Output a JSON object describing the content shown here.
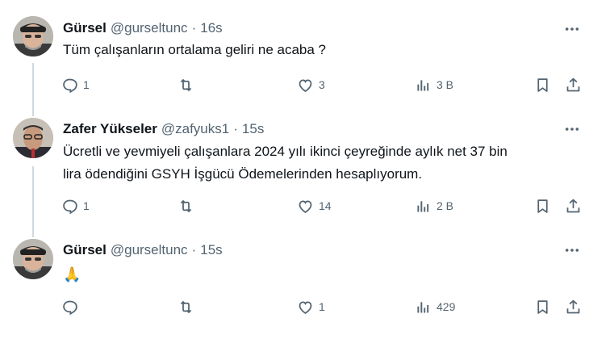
{
  "tweets": [
    {
      "name": "Gürsel",
      "handle": "@gurseltunc",
      "dot": "·",
      "time": "16s",
      "text": "Tüm çalışanların ortalama geliri ne acaba ?",
      "replies": "1",
      "retweets": "",
      "likes": "3",
      "views": "3 B"
    },
    {
      "name": "Zafer Yükseler",
      "handle": "@zafyuks1",
      "dot": "·",
      "time": "15s",
      "text_line1": "Ücretli ve yevmiyeli çalışanlara 2024 yılı ikinci çeyreğinde aylık net 37 bin",
      "text_line2": "lira ödendiğini GSYH İşgücü Ödemelerinden hesaplıyorum.",
      "replies": "1",
      "retweets": "",
      "likes": "14",
      "views": "2 B"
    },
    {
      "name": "Gürsel",
      "handle": "@gurseltunc",
      "dot": "·",
      "time": "15s",
      "text": "🙏",
      "replies": "",
      "retweets": "",
      "likes": "1",
      "views": "429"
    }
  ],
  "icons": {
    "more": "more-dots-icon",
    "reply": "reply-icon",
    "retweet": "retweet-icon",
    "like": "heart-icon",
    "views": "views-chart-icon",
    "bookmark": "bookmark-icon",
    "share": "share-icon"
  },
  "colors": {
    "text_primary": "#0f1419",
    "text_secondary": "#536471",
    "thread_line": "#cfd9de",
    "background": "#ffffff"
  }
}
